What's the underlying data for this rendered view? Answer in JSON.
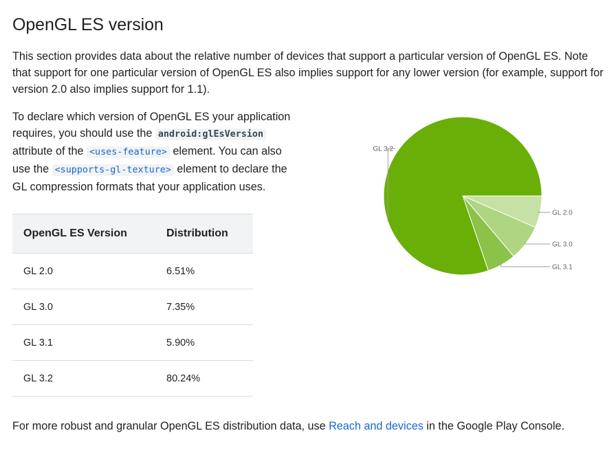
{
  "page": {
    "title": "OpenGL ES version",
    "intro": "This section provides data about the relative number of devices that support a particular version of OpenGL ES. Note that support for one particular version of OpenGL ES also implies support for any lower version (for example, support for version 2.0 also implies support for 1.1).",
    "declare": {
      "part1": "To declare which version of OpenGL ES your application requires, you should use the ",
      "code1": "android:glEsVersion",
      "part2": " attribute of the ",
      "code2": "<uses-feature>",
      "part3": " element. You can also use the ",
      "code3": "<supports-gl-texture>",
      "part4": " element to declare the GL compression formats that your application uses."
    },
    "footer": {
      "before": "For more robust and granular OpenGL ES distribution data, use ",
      "link": "Reach and devices",
      "after": " in the Google Play Console."
    }
  },
  "table": {
    "headers": [
      "OpenGL ES Version",
      "Distribution"
    ],
    "rows": [
      [
        "GL 2.0",
        "6.51%"
      ],
      [
        "GL 3.0",
        "7.35%"
      ],
      [
        "GL 3.1",
        "5.90%"
      ],
      [
        "GL 3.2",
        "80.24%"
      ]
    ]
  },
  "chart_data": {
    "type": "pie",
    "categories": [
      "GL 2.0",
      "GL 3.0",
      "GL 3.1",
      "GL 3.2"
    ],
    "values": [
      6.51,
      7.35,
      5.9,
      80.24
    ],
    "colors": [
      "#c5e1a5",
      "#aed581",
      "#8bc34a",
      "#6aaf08"
    ],
    "title": ""
  }
}
